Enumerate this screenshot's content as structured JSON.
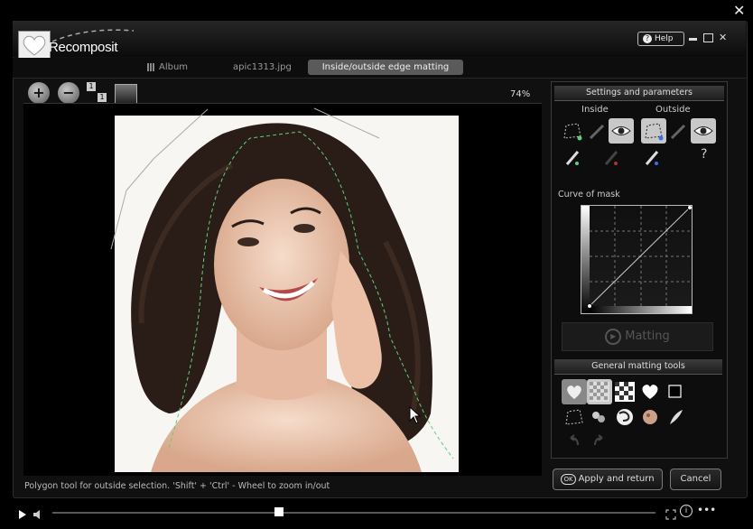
{
  "window": {
    "app_name": "Recomposit",
    "help_label": "Help",
    "close_glyph": "✕"
  },
  "tabs": [
    {
      "label": "Album",
      "icon": "grid-icon"
    },
    {
      "label": "apic1313.jpg"
    },
    {
      "label": "Inside/outside edge matting",
      "active": true
    }
  ],
  "toolbar": {
    "zoom_in": "+",
    "zoom_out": "−",
    "zoom_level": "74%",
    "one_to_one_a": "1",
    "one_to_one_b": "1"
  },
  "panel": {
    "settings_title": "Settings and parameters",
    "inside_label": "Inside",
    "outside_label": "Outside",
    "help_glyph": "?",
    "curve_label": "Curve of mask",
    "matting_label": "Matting",
    "general_title": "General matting tools"
  },
  "buttons": {
    "ok_icon": "OK",
    "apply_label": "Apply and return",
    "cancel_label": "Cancel"
  },
  "status_text": "Polygon tool for outside selection. 'Shift' + 'Ctrl' - Wheel to zoom in/out",
  "colors": {
    "accent_green": "#5fd07a",
    "selected_tool": "#c8c8c8",
    "panel_bg": "#0d0d0d"
  }
}
